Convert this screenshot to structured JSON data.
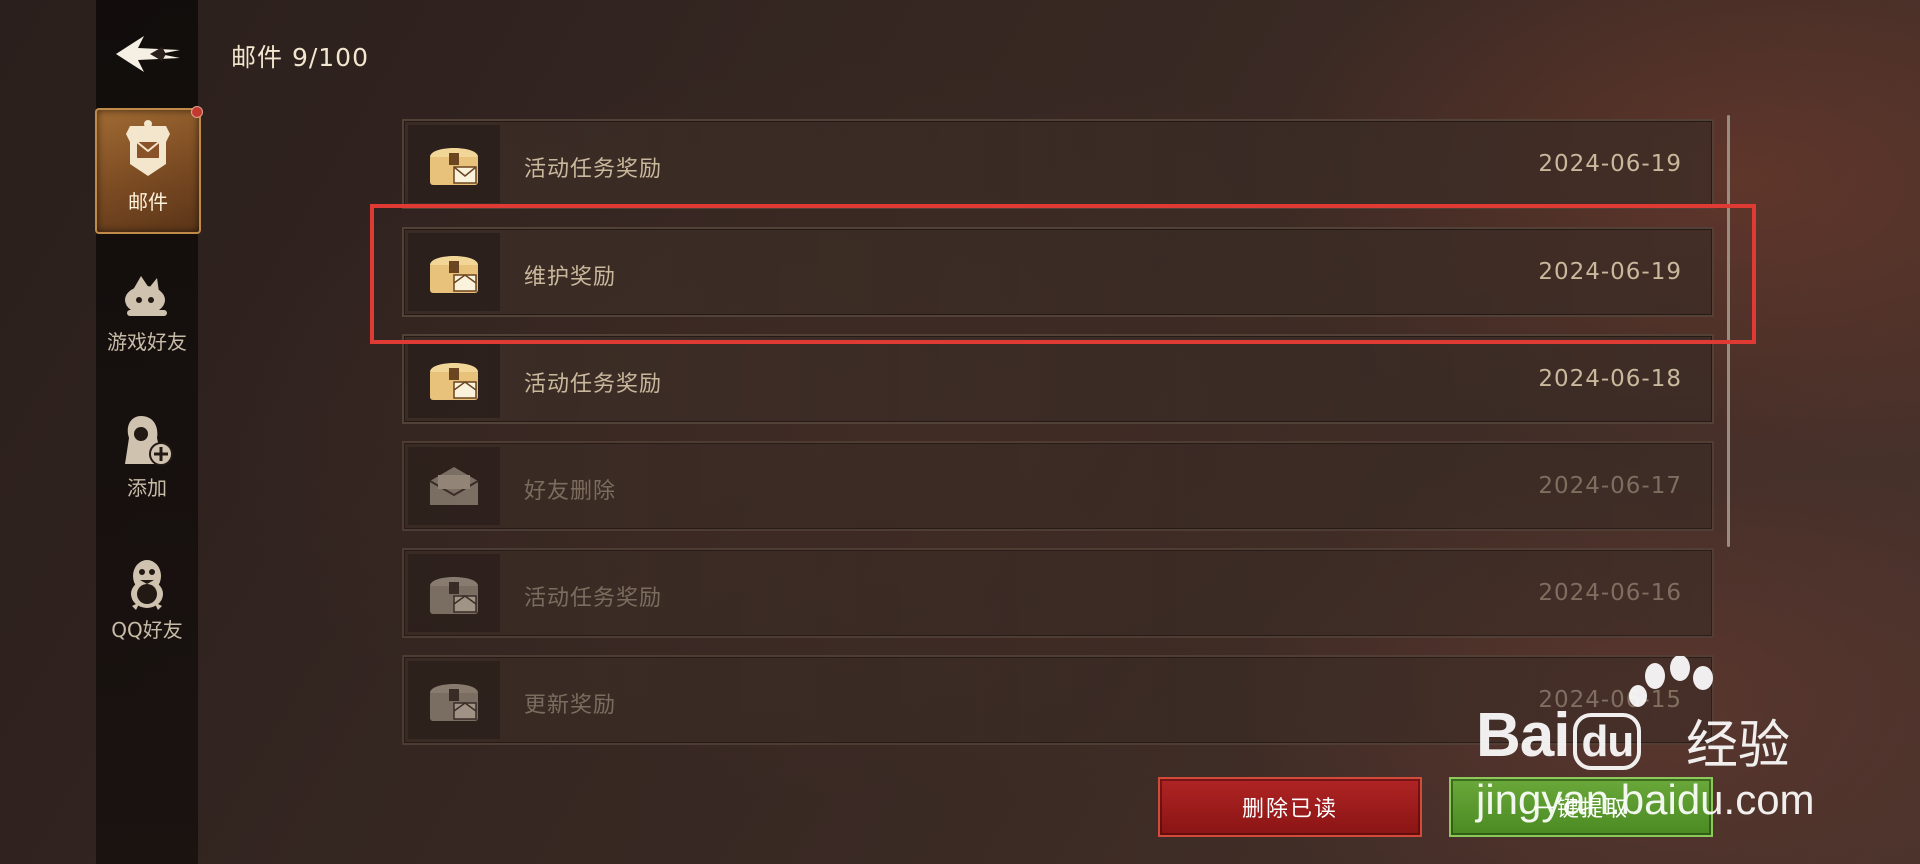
{
  "header": {
    "title": "邮件 9/100"
  },
  "sidebar": {
    "items": [
      {
        "label": "邮件",
        "active": true
      },
      {
        "label": "游戏好友",
        "active": false
      },
      {
        "label": "添加",
        "active": false
      },
      {
        "label": "QQ好友",
        "active": false
      }
    ]
  },
  "mails": [
    {
      "subject": "活动任务奖励",
      "date": "2024-06-19",
      "icon": "treasure-chest-mail-icon",
      "state": "unread"
    },
    {
      "subject": "维护奖励",
      "date": "2024-06-19",
      "icon": "treasure-chest-mail-icon",
      "state": "unread"
    },
    {
      "subject": "活动任务奖励",
      "date": "2024-06-18",
      "icon": "treasure-chest-mail-icon",
      "state": "unread"
    },
    {
      "subject": "好友删除",
      "date": "2024-06-17",
      "icon": "envelope-icon",
      "state": "read"
    },
    {
      "subject": "活动任务奖励",
      "date": "2024-06-16",
      "icon": "treasure-chest-mail-icon",
      "state": "read"
    },
    {
      "subject": "更新奖励",
      "date": "2024-06-15",
      "icon": "treasure-chest-mail-icon",
      "state": "read"
    }
  ],
  "actions": {
    "delete_read": "删除已读",
    "claim_all": "一键提取"
  },
  "watermark": {
    "brand": "Bai",
    "brand_suffix": "du",
    "product": "经验",
    "url": "jingyan.baidu.com"
  },
  "colors": {
    "highlight": "#e03a35",
    "delete_button": "#9c1c1c",
    "claim_button": "#5a9a2c"
  }
}
